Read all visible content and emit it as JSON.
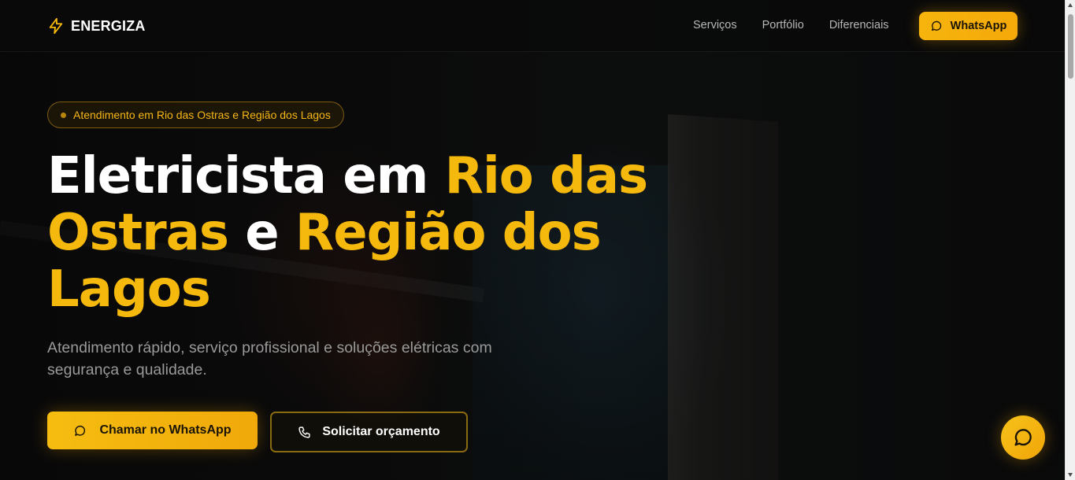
{
  "header": {
    "brand": "ENERGIZA",
    "nav": [
      "Serviços",
      "Portfólio",
      "Diferenciais"
    ],
    "whatsapp_label": "WhatsApp"
  },
  "hero": {
    "badge": "Atendimento em Rio das Ostras e Região dos Lagos",
    "headline": {
      "part1": "Eletricista em ",
      "part2": "Rio das Ostras",
      "part3": " e ",
      "part4": "Região dos Lagos"
    },
    "subtitle": "Atendimento rápido, serviço profissional e soluções elétricas com segurança e qualidade.",
    "primary_button": "Chamar no WhatsApp",
    "secondary_button": "Solicitar orçamento"
  },
  "colors": {
    "accent": "#f5b80c",
    "background": "#0a0a0a",
    "muted_text": "#9a9a9a"
  },
  "icons": {
    "logo": "lightning-bolt-icon",
    "whatsapp": "chat-bubble-icon",
    "phone": "phone-icon",
    "fab": "chat-bubble-icon"
  }
}
